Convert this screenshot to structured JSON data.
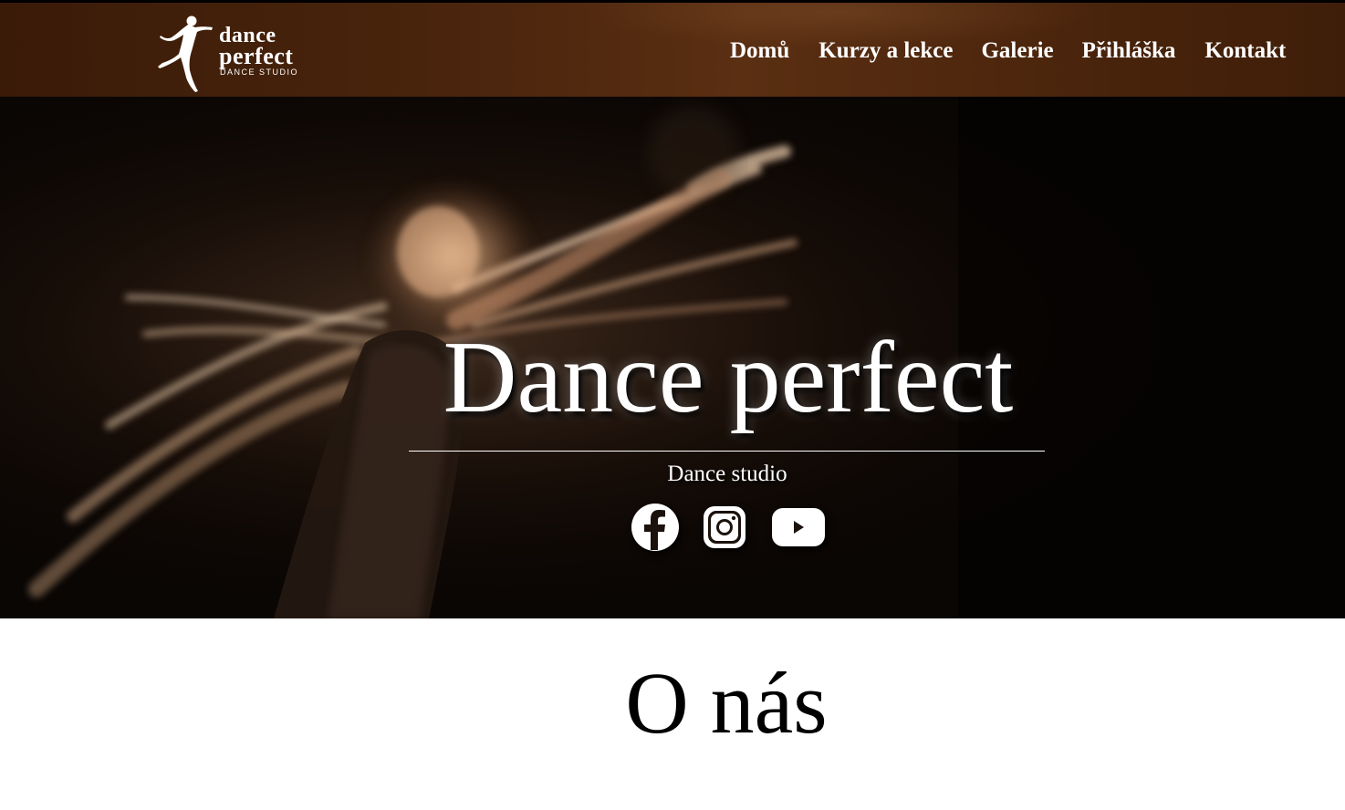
{
  "header": {
    "logo": {
      "line1": "dance",
      "line2": "perfect",
      "line3": "DANCE STUDIO"
    },
    "nav": [
      {
        "label": "Domů"
      },
      {
        "label": "Kurzy a lekce"
      },
      {
        "label": "Galerie"
      },
      {
        "label": "Přihláška"
      },
      {
        "label": "Kontakt"
      }
    ]
  },
  "hero": {
    "title": "Dance perfect",
    "subtitle": "Dance studio",
    "social": [
      {
        "icon": "facebook-icon"
      },
      {
        "icon": "instagram-icon"
      },
      {
        "icon": "youtube-icon"
      }
    ]
  },
  "about": {
    "heading": "O nás"
  },
  "colors": {
    "header_bg": "#4b250d",
    "text": "#ffffff"
  }
}
